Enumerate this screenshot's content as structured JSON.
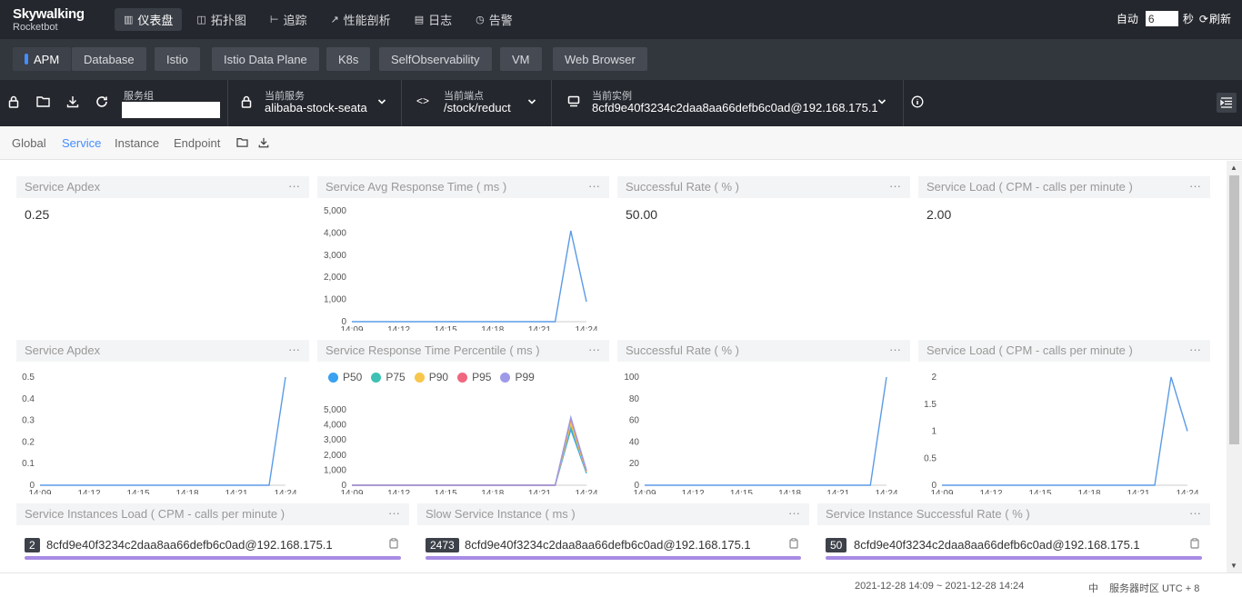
{
  "brand": {
    "name": "Skywalking",
    "sub": "Rocketbot"
  },
  "nav": [
    {
      "label": "仪表盘",
      "icon": "dashboard-icon",
      "glyph": "▥",
      "active": true
    },
    {
      "label": "拓扑图",
      "icon": "topology-icon",
      "glyph": "◫",
      "active": false
    },
    {
      "label": "追踪",
      "icon": "trace-icon",
      "glyph": "⊢",
      "active": false
    },
    {
      "label": "性能剖析",
      "icon": "profile-icon",
      "glyph": "↗",
      "active": false
    },
    {
      "label": "日志",
      "icon": "log-icon",
      "glyph": "▤",
      "active": false
    },
    {
      "label": "告警",
      "icon": "alarm-icon",
      "glyph": "◷",
      "active": false
    }
  ],
  "topbar": {
    "auto_label": "自动",
    "auto_value": "6",
    "seconds_label": "秒",
    "refresh_label": "刷新"
  },
  "layers": [
    "APM",
    "Database",
    "Istio",
    "Istio Data Plane",
    "K8s",
    "SelfObservability",
    "VM",
    "Web Browser"
  ],
  "selectors": {
    "group_label": "服务组",
    "group_value": "",
    "service_label": "当前服务",
    "service_value": "alibaba-stock-seata",
    "endpoint_label": "当前端点",
    "endpoint_value": "/stock/reduct",
    "instance_label": "当前实例",
    "instance_value": "8cfd9e40f3234c2daa8aa66defb6c0ad@192.168.175.1"
  },
  "subtabs": [
    "Global",
    "Service",
    "Instance",
    "Endpoint"
  ],
  "cards": {
    "apdex_title": "Service Apdex",
    "apdex_value": "0.25",
    "avg_rt_title": "Service Avg Response Time ( ms )",
    "success_title": "Successful Rate ( % )",
    "success_value": "50.00",
    "load_title": "Service Load ( CPM - calls per minute )",
    "load_value": "2.00",
    "apdex2_title": "Service Apdex",
    "percentile_title": "Service Response Time Percentile ( ms )",
    "success2_title": "Successful Rate ( % )",
    "load2_title": "Service Load ( CPM - calls per minute )",
    "inst_load_title": "Service Instances Load ( CPM - calls per minute )",
    "slow_inst_title": "Slow Service Instance ( ms )",
    "inst_success_title": "Service Instance Successful Rate ( % )",
    "more": "···"
  },
  "percentile_legend": [
    {
      "name": "P50",
      "color": "#3aa0f0"
    },
    {
      "name": "P75",
      "color": "#3cc1b4"
    },
    {
      "name": "P90",
      "color": "#f8c64a"
    },
    {
      "name": "P95",
      "color": "#f0687f"
    },
    {
      "name": "P99",
      "color": "#9d9be8"
    }
  ],
  "instance_lists": {
    "load": {
      "value": "2",
      "name": "8cfd9e40f3234c2daa8aa66defb6c0ad@192.168.175.1"
    },
    "slow": {
      "value": "2473",
      "name": "8cfd9e40f3234c2daa8aa66defb6c0ad@192.168.175.1"
    },
    "success": {
      "value": "50",
      "name": "8cfd9e40f3234c2daa8aa66defb6c0ad@192.168.175.1"
    }
  },
  "footer": {
    "range": "2021-12-28 14:09 ~ 2021-12-28 14:24",
    "lang": "中",
    "timezone": "服务器时区 UTC + 8"
  },
  "chart_data": [
    {
      "id": "avg-response-time",
      "type": "line",
      "x": [
        "14:09\n12-28",
        "",
        "",
        "14:12\n12-28",
        "",
        "",
        "14:15\n12-28",
        "",
        "",
        "14:18\n12-28",
        "",
        "",
        "14:21\n12-28",
        "",
        "",
        "14:24\n12-28"
      ],
      "ylim": [
        0,
        5000
      ],
      "yticks": [
        0,
        1000,
        2000,
        3000,
        4000,
        5000
      ],
      "series": [
        {
          "color": "#5b9be6",
          "values": [
            0,
            0,
            0,
            0,
            0,
            0,
            0,
            0,
            0,
            0,
            0,
            0,
            0,
            0,
            4100,
            900
          ]
        }
      ]
    },
    {
      "id": "apdex",
      "type": "line",
      "x": [
        "14:09\n12-28",
        "",
        "",
        "14:12\n12-28",
        "",
        "",
        "14:15\n12-28",
        "",
        "",
        "14:18\n12-28",
        "",
        "",
        "14:21\n12-28",
        "",
        "",
        "14:24\n12-28"
      ],
      "ylim": [
        0,
        0.5
      ],
      "yticks": [
        0,
        0.1,
        0.2,
        0.3,
        0.4,
        0.5
      ],
      "series": [
        {
          "color": "#5b9be6",
          "values": [
            0,
            0,
            0,
            0,
            0,
            0,
            0,
            0,
            0,
            0,
            0,
            0,
            0,
            0,
            0,
            0.5
          ]
        }
      ]
    },
    {
      "id": "percentile",
      "type": "line",
      "x": [
        "14:09\n12-28",
        "",
        "",
        "14:12\n12-28",
        "",
        "",
        "14:15\n12-28",
        "",
        "",
        "14:18\n12-28",
        "",
        "",
        "14:21\n12-28",
        "",
        "",
        "14:24\n12-28"
      ],
      "ylim": [
        0,
        5000
      ],
      "yticks": [
        0,
        1000,
        2000,
        3000,
        4000,
        5000
      ],
      "series": [
        {
          "name": "P50",
          "color": "#3aa0f0",
          "values": [
            0,
            0,
            0,
            0,
            0,
            0,
            0,
            0,
            0,
            0,
            0,
            0,
            0,
            0,
            3700,
            800
          ]
        },
        {
          "name": "P75",
          "color": "#3cc1b4",
          "values": [
            0,
            0,
            0,
            0,
            0,
            0,
            0,
            0,
            0,
            0,
            0,
            0,
            0,
            0,
            3900,
            850
          ]
        },
        {
          "name": "P90",
          "color": "#f8c64a",
          "values": [
            0,
            0,
            0,
            0,
            0,
            0,
            0,
            0,
            0,
            0,
            0,
            0,
            0,
            0,
            4100,
            900
          ]
        },
        {
          "name": "P95",
          "color": "#f0687f",
          "values": [
            0,
            0,
            0,
            0,
            0,
            0,
            0,
            0,
            0,
            0,
            0,
            0,
            0,
            0,
            4400,
            950
          ]
        },
        {
          "name": "P99",
          "color": "#9d9be8",
          "values": [
            0,
            0,
            0,
            0,
            0,
            0,
            0,
            0,
            0,
            0,
            0,
            0,
            0,
            0,
            4500,
            1000
          ]
        }
      ]
    },
    {
      "id": "successful-rate",
      "type": "line",
      "x": [
        "14:09\n12-28",
        "",
        "",
        "14:12\n12-28",
        "",
        "",
        "14:15\n12-28",
        "",
        "",
        "14:18\n12-28",
        "",
        "",
        "14:21\n12-28",
        "",
        "",
        "14:24\n12-28"
      ],
      "ylim": [
        0,
        100
      ],
      "yticks": [
        0,
        20,
        40,
        60,
        80,
        100
      ],
      "series": [
        {
          "color": "#5b9be6",
          "values": [
            0,
            0,
            0,
            0,
            0,
            0,
            0,
            0,
            0,
            0,
            0,
            0,
            0,
            0,
            0,
            100
          ]
        }
      ]
    },
    {
      "id": "service-load",
      "type": "line",
      "x": [
        "14:09\n12-28",
        "",
        "",
        "14:12\n12-28",
        "",
        "",
        "14:15\n12-28",
        "",
        "",
        "14:18\n12-28",
        "",
        "",
        "14:21\n12-28",
        "",
        "",
        "14:24\n12-28"
      ],
      "ylim": [
        0,
        2
      ],
      "yticks": [
        0,
        0.5,
        1,
        1.5,
        2
      ],
      "series": [
        {
          "color": "#5b9be6",
          "values": [
            0,
            0,
            0,
            0,
            0,
            0,
            0,
            0,
            0,
            0,
            0,
            0,
            0,
            0,
            2,
            1
          ]
        }
      ]
    }
  ]
}
